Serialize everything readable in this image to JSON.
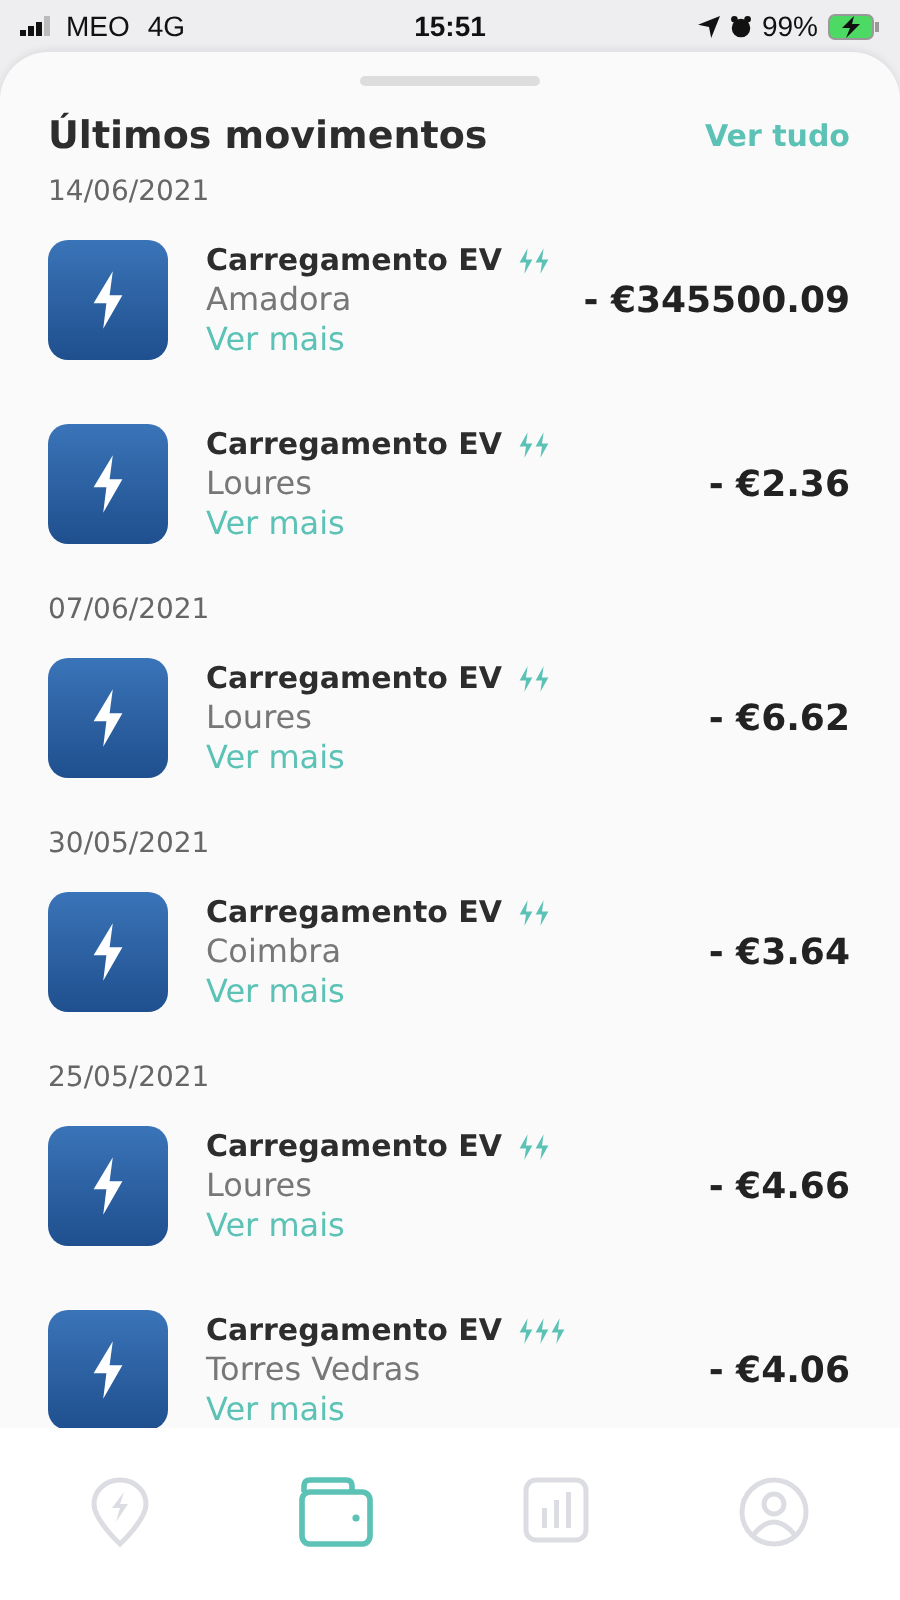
{
  "status_bar": {
    "carrier": "MEO",
    "network": "4G",
    "time": "15:51",
    "battery": "99%"
  },
  "section": {
    "title": "Últimos movimentos",
    "link": "Ver tudo"
  },
  "groups": [
    {
      "date": "14/06/2021",
      "items": [
        {
          "title": "Carregamento EV",
          "kind": "fast",
          "place": "Amadora",
          "link": "Ver mais",
          "amount": "- €345500.09"
        },
        {
          "title": "Carregamento EV",
          "kind": "fast",
          "place": "Loures",
          "link": "Ver mais",
          "amount": "- €2.36"
        }
      ]
    },
    {
      "date": "07/06/2021",
      "items": [
        {
          "title": "Carregamento EV",
          "kind": "fast",
          "place": "Loures",
          "link": "Ver mais",
          "amount": "- €6.62"
        }
      ]
    },
    {
      "date": "30/05/2021",
      "items": [
        {
          "title": "Carregamento EV",
          "kind": "fast",
          "place": "Coimbra",
          "link": "Ver mais",
          "amount": "- €3.64"
        }
      ]
    },
    {
      "date": "25/05/2021",
      "items": [
        {
          "title": "Carregamento EV",
          "kind": "fast",
          "place": "Loures",
          "link": "Ver mais",
          "amount": "- €4.66"
        },
        {
          "title": "Carregamento EV",
          "kind": "rapid",
          "place": "Torres Vedras",
          "link": "Ver mais",
          "amount": "- €4.06"
        }
      ]
    }
  ],
  "tab_bar": [
    {
      "kind": "map",
      "selected": false
    },
    {
      "kind": "wallet",
      "selected": true
    },
    {
      "kind": "stats",
      "selected": false
    },
    {
      "kind": "profile",
      "selected": false
    }
  ]
}
